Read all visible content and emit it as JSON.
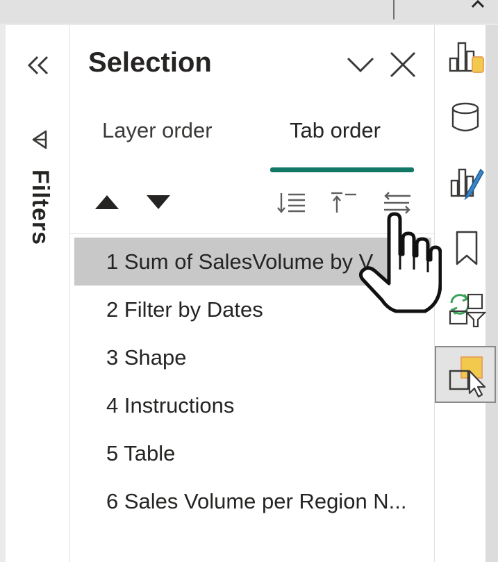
{
  "filters_pane": {
    "label": "Filters"
  },
  "selection_pane": {
    "title": "Selection",
    "tabs": [
      {
        "label": "Layer order",
        "active": false
      },
      {
        "label": "Tab order",
        "active": true
      }
    ],
    "items": [
      {
        "label": "1 Sum of SalesVolume by V",
        "selected": true
      },
      {
        "label": "2 Filter by Dates",
        "selected": false
      },
      {
        "label": "3 Shape",
        "selected": false
      },
      {
        "label": "4 Instructions",
        "selected": false
      },
      {
        "label": "5 Table",
        "selected": false
      },
      {
        "label": "6 Sales Volume per Region N...",
        "selected": false
      }
    ]
  },
  "right_toolbar": {
    "icons": [
      "build-visual-icon",
      "data-icon",
      "format-visual-icon",
      "bookmark-icon",
      "sync-slicers-icon",
      "selection-icon"
    ],
    "active": "selection-icon"
  },
  "colors": {
    "accent": "#117865",
    "selected_row": "#c8c8c8",
    "icon_yellow": "#f2c94c",
    "icon_orange": "#e9a35b",
    "icon_blue": "#3a86c8",
    "icon_green": "#3aa35a"
  }
}
